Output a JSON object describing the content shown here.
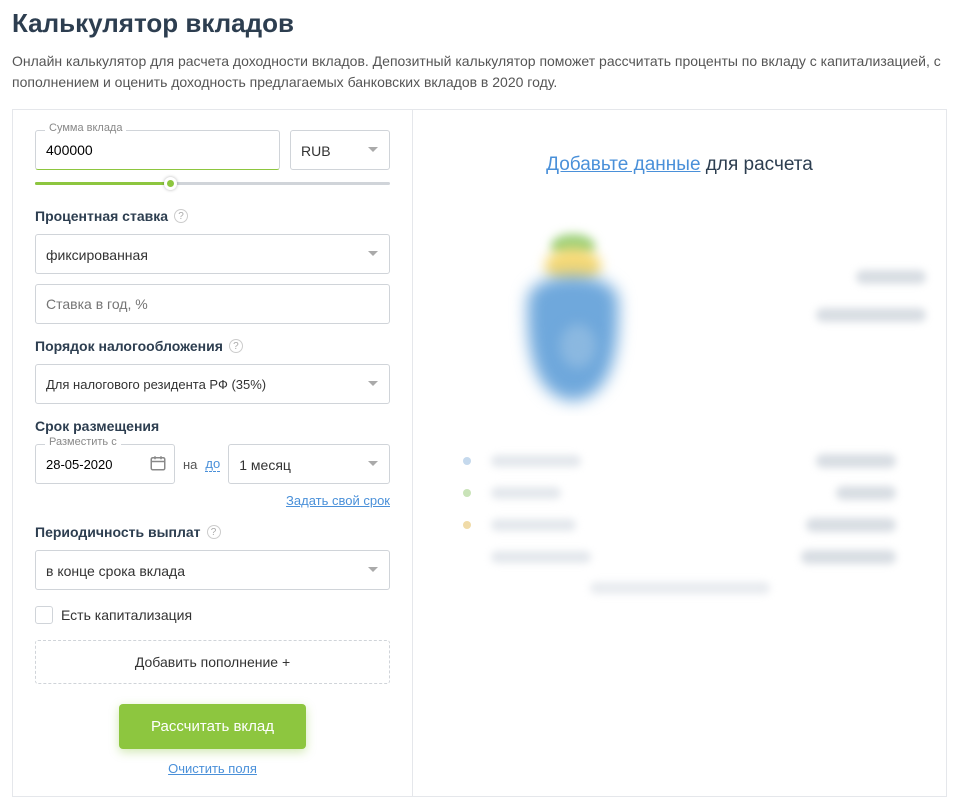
{
  "page": {
    "title": "Калькулятор вкладов",
    "description": "Онлайн калькулятор для расчета доходности вкладов. Депозитный калькулятор поможет рассчитать проценты по вкладу с капитализацией, с пополнением и оценить доходность предлагаемых банковских вкладов в 2020 году."
  },
  "form": {
    "amount_label": "Сумма вклада",
    "amount_value": "400000",
    "currency": "RUB",
    "rate_section": "Процентная ставка",
    "rate_type": "фиксированная",
    "rate_placeholder": "Ставка в год, %",
    "tax_section": "Порядок налогообложения",
    "tax_option": "Для налогового резидента РФ (35%)",
    "term_section": "Срок размещения",
    "date_label": "Разместить с",
    "date_value": "28-05-2020",
    "sep_na": "на",
    "sep_do": "до",
    "term_value": "1 месяц",
    "custom_term": "Задать свой срок",
    "payout_section": "Периодичность выплат",
    "payout_value": "в конце срока вклада",
    "capitalization": "Есть капитализация",
    "add_deposit": "Добавить пополнение +",
    "submit": "Рассчитать вклад",
    "clear": "Очистить поля"
  },
  "result": {
    "title_highlight": "Добавьте данные",
    "title_rest": " для расчета"
  }
}
